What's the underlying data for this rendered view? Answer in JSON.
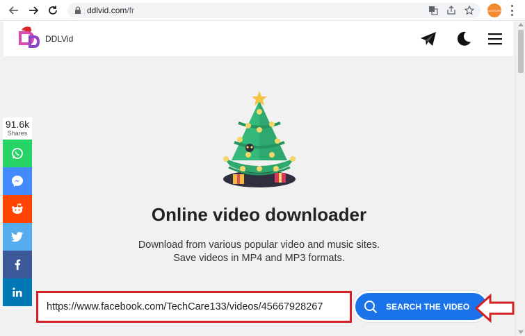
{
  "browser": {
    "url_host": "ddlvid.com",
    "url_path": "/fr",
    "profile_label": "ADVISORS"
  },
  "site": {
    "brand": "DDLVid",
    "hero_title": "Online video downloader",
    "hero_sub_line1": "Download from various popular video and music sites.",
    "hero_sub_line2": "Save videos in MP4 and MP3 formats."
  },
  "share": {
    "count": "91.6k",
    "label": "Shares",
    "networks": [
      {
        "name": "whatsapp",
        "color": "#25d366"
      },
      {
        "name": "messenger",
        "color": "#448aff"
      },
      {
        "name": "reddit",
        "color": "#ff4500"
      },
      {
        "name": "twitter",
        "color": "#55acee"
      },
      {
        "name": "facebook",
        "color": "#3b5998"
      },
      {
        "name": "linkedin",
        "color": "#0077b5"
      }
    ]
  },
  "search": {
    "input_value": "https://www.facebook.com/TechCare133/videos/45667928267",
    "button_label": "SEARCH THE VIDEO"
  },
  "colors": {
    "accent": "#1a73e8",
    "highlight": "#d42027"
  }
}
